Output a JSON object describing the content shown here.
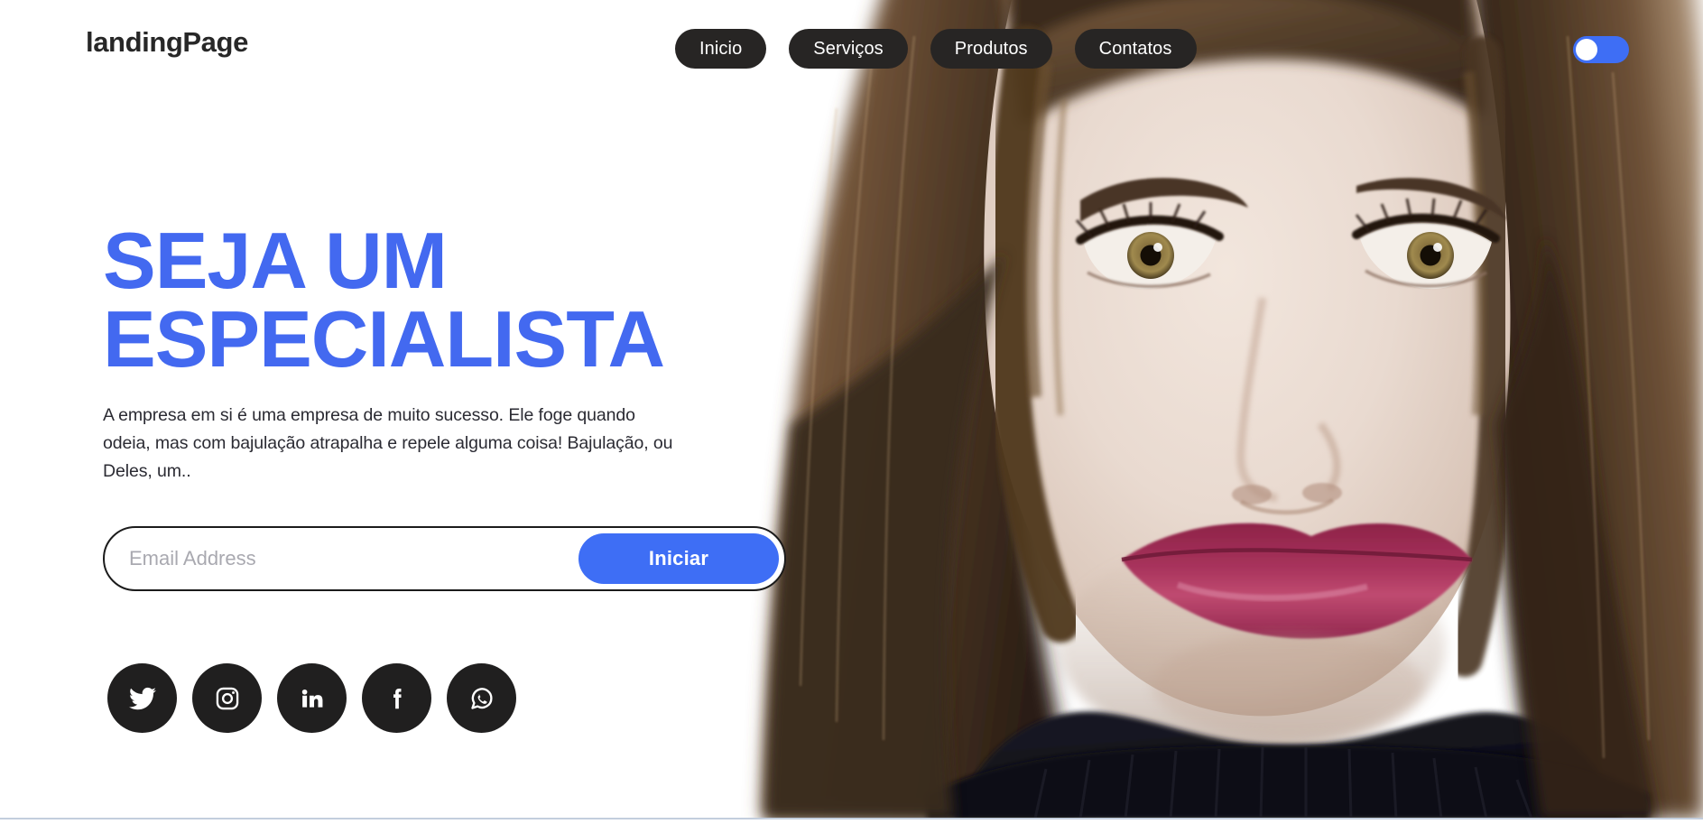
{
  "brand": {
    "name": "landingPage"
  },
  "nav": {
    "items": [
      {
        "label": "Inicio",
        "name": "nav-inicio"
      },
      {
        "label": "Serviços",
        "name": "nav-servicos"
      },
      {
        "label": "Produtos",
        "name": "nav-produtos"
      },
      {
        "label": "Contatos",
        "name": "nav-contatos"
      }
    ]
  },
  "toggle": {
    "state": "off",
    "icon": "toggle-switch"
  },
  "hero": {
    "title": "SEJA UM\nESPECIALISTA",
    "paragraph": "A empresa em si é uma empresa de muito sucesso. Ele foge quando odeia, mas com bajulação atrapalha e repele alguma coisa! Bajulação, ou Deles, um..",
    "image_alt": "portrait-photo-woman"
  },
  "signup": {
    "placeholder": "Email Address",
    "value": "",
    "button_label": "Iniciar"
  },
  "socials": [
    {
      "name": "twitter-icon",
      "label": "Twitter"
    },
    {
      "name": "instagram-icon",
      "label": "Instagram"
    },
    {
      "name": "linkedin-icon",
      "label": "LinkedIn"
    },
    {
      "name": "facebook-icon",
      "label": "Facebook"
    },
    {
      "name": "whatsapp-icon",
      "label": "WhatsApp"
    }
  ],
  "colors": {
    "accent_blue": "#3e6ef5",
    "title_blue": "#4369f0",
    "dark_pill": "#272524",
    "social_circle": "#201f1f",
    "text_dark": "#2b2b33",
    "placeholder_gray": "#a9a9b0",
    "page_bg": "#ffffff",
    "lips": "#a8335c",
    "sweater": "#13131c",
    "hair": "#6b4a31",
    "skin": "#e7d8cf"
  }
}
